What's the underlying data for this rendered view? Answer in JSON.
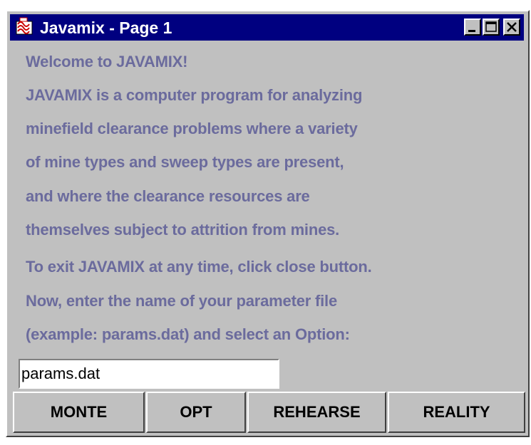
{
  "window": {
    "title": "Javamix - Page 1",
    "app_icon": "javamix-app-icon",
    "controls": {
      "minimize_icon": "minimize-icon",
      "maximize_icon": "maximize-icon",
      "close_icon": "close-icon"
    }
  },
  "content": {
    "lines": [
      "Welcome to JAVAMIX!",
      "JAVAMIX is a  computer  program  for  analyzing",
      "minefield clearance problems where a  variety",
      "of mine types and  sweep  types  are  present,",
      "and  where  the  clearance  resources  are",
      "themselves subject to attrition from mines.",
      "To exit JAVAMIX at any time, click close button.",
      "Now, enter the name of your  parameter file",
      "(example: params.dat) and select an Option:"
    ]
  },
  "param_file": {
    "value": "params.dat"
  },
  "options": {
    "monte": "MONTE",
    "opt": "OPT",
    "rehearse": "REHEARSE",
    "reality": "REALITY"
  },
  "colors": {
    "titlebar": "#000080",
    "window_bg": "#c0c0c0",
    "text": "#6b6b9d"
  }
}
